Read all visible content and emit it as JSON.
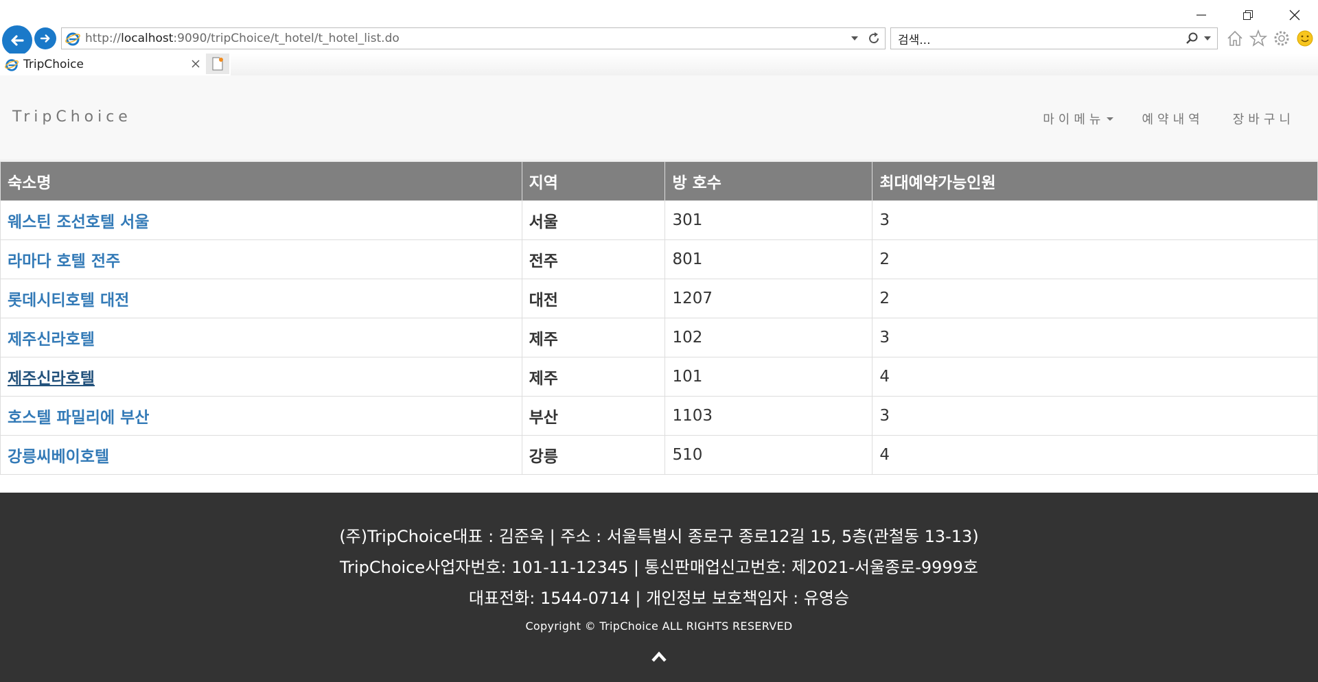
{
  "browser": {
    "url_prefix": "http://",
    "url_host": "localhost",
    "url_rest": ":9090/tripChoice/t_hotel/t_hotel_list.do",
    "search_placeholder": "검색...",
    "tab_title": "TripChoice",
    "accent_color": "#1a79c9"
  },
  "header": {
    "brand": "TripChoice",
    "nav": [
      {
        "label": "마이메뉴",
        "has_dropdown": true
      },
      {
        "label": "예약내역"
      },
      {
        "label": "장바구니"
      }
    ]
  },
  "table": {
    "columns": [
      "숙소명",
      "지역",
      "방 호수",
      "최대예약가능인원"
    ],
    "rows": [
      {
        "name": "웨스틴 조선호텔 서울",
        "region": "서울",
        "room": "301",
        "max": "3"
      },
      {
        "name": "라마다 호텔 전주",
        "region": "전주",
        "room": "801",
        "max": "2"
      },
      {
        "name": "롯데시티호텔 대전",
        "region": "대전",
        "room": "1207",
        "max": "2"
      },
      {
        "name": "제주신라호텔",
        "region": "제주",
        "room": "102",
        "max": "3"
      },
      {
        "name": "제주신라호텔",
        "region": "제주",
        "room": "101",
        "max": "4",
        "hovered": true
      },
      {
        "name": "호스텔 파밀리에 부산",
        "region": "부산",
        "room": "1103",
        "max": "3"
      },
      {
        "name": "강릉씨베이호텔",
        "region": "강릉",
        "room": "510",
        "max": "4"
      }
    ]
  },
  "footer": {
    "line1": "(주)TripChoice대표 : 김준욱 | 주소 : 서울특별시 종로구 종로12길 15, 5층(관철동 13-13)",
    "line2": "TripChoice사업자번호: 101-11-12345 | 통신판매업신고번호: 제2021-서울종로-9999호",
    "line3": "대표전화: 1544-0714 | 개인정보 보호책임자 : 유영승",
    "copyright": "Copyright © TripChoice ALL RIGHTS RESERVED",
    "scroll_top_icon": "chevron-up-icon"
  }
}
